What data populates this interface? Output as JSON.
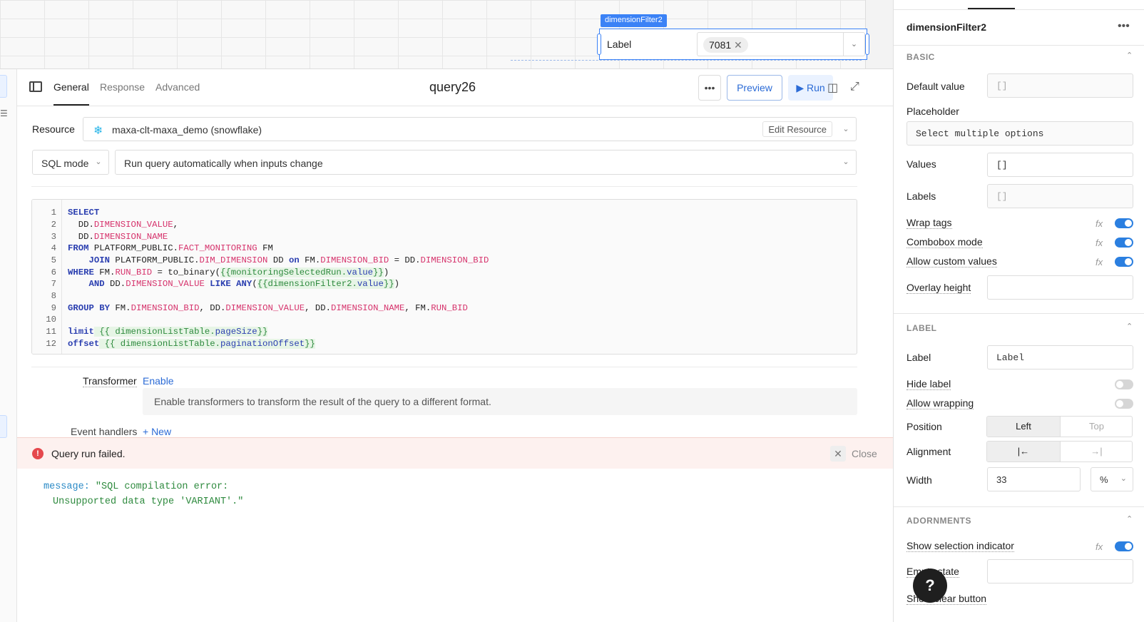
{
  "canvas": {
    "component_tag": "dimensionFilter2",
    "label": "Label",
    "selected_tag": "7081"
  },
  "query": {
    "tabs": [
      "General",
      "Response",
      "Advanced"
    ],
    "title": "query26",
    "preview_label": "Preview",
    "run_label": "Run",
    "resource_label": "Resource",
    "resource_value": "maxa-clt-maxa_demo (snowflake)",
    "edit_resource_label": "Edit Resource",
    "mode_value": "SQL mode",
    "run_trigger_value": "Run query automatically when inputs change",
    "line_numbers": [
      "1",
      "2",
      "3",
      "4",
      "5",
      "6",
      "7",
      "8",
      "9",
      "10",
      "11",
      "12"
    ],
    "transformer_label": "Transformer",
    "transformer_enable": "Enable",
    "transformer_note": "Enable transformers to transform the result of the query to a different format.",
    "event_handlers_label": "Event handlers",
    "event_handlers_new": "+ New"
  },
  "code": {
    "l1": "SELECT",
    "l2_a": "  DD.",
    "l2_b": "DIMENSION_VALUE",
    "l2_c": ",",
    "l3_a": "  DD.",
    "l3_b": "DIMENSION_NAME",
    "l4_a": "FROM",
    "l4_b": " PLATFORM_PUBLIC.",
    "l4_c": "FACT_MONITORING",
    "l4_d": " FM",
    "l5_a": "    JOIN",
    "l5_b": " PLATFORM_PUBLIC.",
    "l5_c": "DIM_DIMENSION",
    "l5_d": " DD ",
    "l5_e": "on",
    "l5_f": " FM.",
    "l5_g": "DIMENSION_BID",
    "l5_h": " = DD.",
    "l5_i": "DIMENSION_BID",
    "l6_a": "WHERE",
    "l6_b": " FM.",
    "l6_c": "RUN_BID",
    "l6_d": " = to_binary(",
    "l6_e": "{{monitoringSelectedRun.",
    "l6_f": "value",
    "l6_g": "}}",
    "l6_h": ")",
    "l7_a": "    AND",
    "l7_b": " DD.",
    "l7_c": "DIMENSION_VALUE",
    "l7_d": " LIKE ANY",
    "l7_e": "(",
    "l7_f": "{{dimensionFilter2.",
    "l7_g": "value",
    "l7_h": "}}",
    "l7_i": ")",
    "l9_a": "GROUP BY",
    "l9_b": " FM.",
    "l9_c": "DIMENSION_BID",
    "l9_d": ", DD.",
    "l9_e": "DIMENSION_VALUE",
    "l9_f": ", DD.",
    "l9_g": "DIMENSION_NAME",
    "l9_h": ", FM.",
    "l9_i": "RUN_BID",
    "l11_a": "limit",
    "l11_b": " {{ dimensionListTable.",
    "l11_c": "pageSize",
    "l11_d": "}}",
    "l12_a": "offset",
    "l12_b": " {{ dimensionListTable.",
    "l12_c": "paginationOffset",
    "l12_d": "}}"
  },
  "error": {
    "title": "Query run failed.",
    "close_label": "Close",
    "key": "message:",
    "line1": " \"SQL compilation error:",
    "line2": "Unsupported data type 'VARIANT'.\""
  },
  "inspector": {
    "component_name": "dimensionFilter2",
    "basic_title": "BASIC",
    "default_value_label": "Default value",
    "default_value_placeholder": "[]",
    "placeholder_label": "Placeholder",
    "placeholder_value": "Select multiple options",
    "values_label": "Values",
    "values_value": "[]",
    "labels_label": "Labels",
    "labels_placeholder": "[]",
    "wrap_tags_label": "Wrap tags",
    "combobox_label": "Combobox mode",
    "custom_values_label": "Allow custom values",
    "overlay_height_label": "Overlay height",
    "fx": "fx",
    "label_title": "LABEL",
    "label_label": "Label",
    "label_value": "Label",
    "hide_label": "Hide label",
    "allow_wrapping": "Allow wrapping",
    "position_label": "Position",
    "position_left": "Left",
    "position_top": "Top",
    "alignment_label": "Alignment",
    "align_left": "|←",
    "align_right": "→|",
    "width_label": "Width",
    "width_value": "33",
    "width_unit": "%",
    "adornments_title": "ADORNMENTS",
    "show_selection": "Show selection indicator",
    "empty_state": "Empty state",
    "show_clear": "Show clear button",
    "toggles": {
      "wrap_tags": true,
      "combobox": true,
      "custom_values": true,
      "hide_label": false,
      "allow_wrapping": false,
      "show_selection": true
    }
  },
  "colors": {
    "accent": "#2b7fe0",
    "error_bg": "#fdf1ef",
    "keyword": "#2b3fb0",
    "field": "#d6336c",
    "string": "#2e8a3e"
  }
}
